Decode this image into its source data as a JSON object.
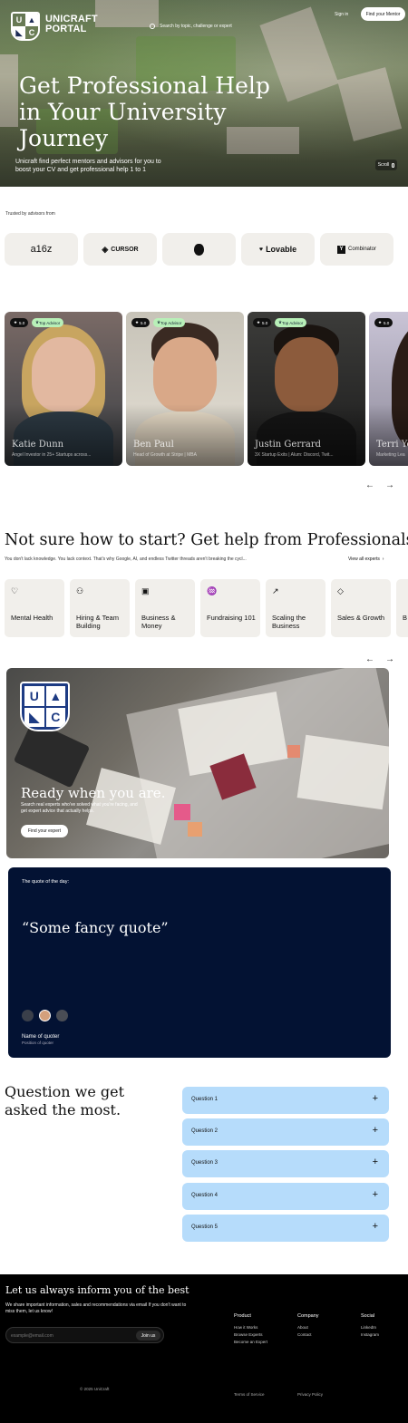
{
  "header": {
    "brand_line1": "UNICRAFT",
    "brand_line2": "PORTAL",
    "logo_letters": [
      "U",
      "",
      "",
      "C"
    ],
    "search_placeholder": "Search by topic, challenge or expert",
    "sign_in": "Sign in",
    "find_mentor": "Find your Mentor"
  },
  "hero": {
    "title_line1": "Get Professional Help",
    "title_line2": "in Your University Journey",
    "subtitle": "Unicraft find perfect mentors and advisors for you to boost your CV and get professional help 1 to 1",
    "scroll_label": "Scroll"
  },
  "trusted": {
    "label": "Trusted by advisors from",
    "logos": [
      "a16z",
      "CURSOR",
      "",
      "Lovable",
      "Combinator"
    ],
    "icons": [
      "",
      "cursor-icon",
      "apple-icon",
      "lovable-icon",
      "y-combinator-icon"
    ]
  },
  "advisors": [
    {
      "rating": "5.0",
      "badge": "Top Advisor",
      "name": "Katie Dunn",
      "desc": "Angel Investor in 25+ Startups across...",
      "extra": "5.0"
    },
    {
      "rating": "5.0",
      "badge": "Top Advisor",
      "name": "Ben Paul",
      "desc": "Head of Growth at Stripe | MBA",
      "extra": ""
    },
    {
      "rating": "5.0",
      "badge": "Top Advisor",
      "name": "Justin Gerrard",
      "desc": "3X Startup Exits | Alum: Discord, Twit...",
      "extra": ""
    },
    {
      "rating": "5.0",
      "badge": "",
      "name": "Terri Yo",
      "desc": "Marketing Lea",
      "extra": ""
    }
  ],
  "help": {
    "title": "Not sure how to start? Get help from Professionals",
    "subtitle": "You don't lack knowledge. You lack context. That's why Google, AI, and endless Twitter threads aren't breaking the cycl...",
    "view_all": "View all experts",
    "categories": [
      {
        "label": "Mental Health",
        "icon": "heart-icon"
      },
      {
        "label": "Hiring & Team Building",
        "icon": "team-icon"
      },
      {
        "label": "Business & Money",
        "icon": "money-icon"
      },
      {
        "label": "Fundraising 101",
        "icon": "fundraising-icon"
      },
      {
        "label": "Scaling the Business",
        "icon": "chart-icon"
      },
      {
        "label": "Sales & Growth",
        "icon": "diamond-icon"
      },
      {
        "label": "B P",
        "icon": ""
      }
    ]
  },
  "ready": {
    "title": "Ready when you are.",
    "subtitle": "Search real experts who've solved what you're facing, and get expert advice that actually helps.",
    "button": "Find your expert",
    "logo_letters": [
      "U",
      "",
      "",
      "C"
    ]
  },
  "quote": {
    "label": "The quote of the day:",
    "text": "“Some fancy quote”",
    "name": "Name of quoter",
    "position": "Position of quoter"
  },
  "faq": {
    "title": "Question we get asked the most.",
    "items": [
      "Question 1",
      "Question 2",
      "Question 3",
      "Question 4",
      "Question 5"
    ]
  },
  "footer": {
    "title": "Let us always inform you of the best",
    "subtitle": "We share important information, sales and recommendations via email If you don't want to miss them, let us know!",
    "email_placeholder": "example@email.com",
    "join": "Join us",
    "columns": [
      {
        "title": "Product",
        "links": [
          "How it Works",
          "Browse Experts",
          "Become an Expert"
        ]
      },
      {
        "title": "Company",
        "links": [
          "About",
          "Contact"
        ]
      },
      {
        "title": "Social",
        "links": [
          "LinkedIn",
          "Instagram"
        ]
      }
    ],
    "copyright": "© 2025 UniCraft",
    "terms": "Terms of Service",
    "privacy": "Privacy Policy"
  }
}
